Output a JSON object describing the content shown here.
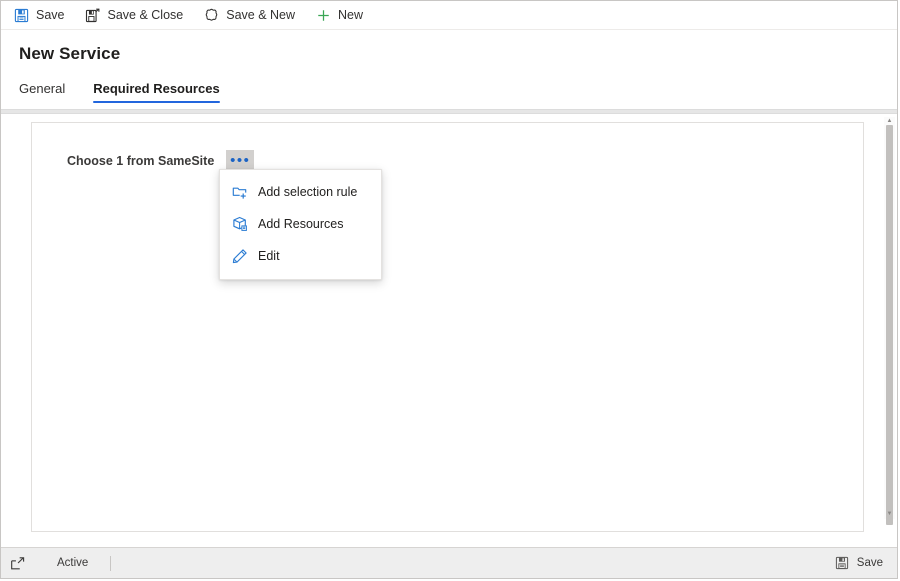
{
  "toolbar": {
    "buttons": [
      {
        "label": "Save",
        "icon": "save-floppy-icon"
      },
      {
        "label": "Save & Close",
        "icon": "save-close-icon"
      },
      {
        "label": "Save & New",
        "icon": "save-new-icon"
      },
      {
        "label": "New",
        "icon": "plus-icon"
      }
    ]
  },
  "header": {
    "title": "New Service",
    "tabs": [
      {
        "label": "General",
        "active": false
      },
      {
        "label": "Required Resources",
        "active": true
      }
    ]
  },
  "content": {
    "field_label": "Choose 1 from SameSite",
    "ellipsis_label": "•••"
  },
  "context_menu": {
    "items": [
      {
        "label": "Add selection rule",
        "icon": "add-selection-rule-icon"
      },
      {
        "label": "Add Resources",
        "icon": "add-resources-box-icon"
      },
      {
        "label": "Edit",
        "icon": "edit-pencil-icon"
      }
    ]
  },
  "statusbar": {
    "popout_icon": "popout-expand-icon",
    "status": "Active",
    "save_label": "Save",
    "save_icon": "save-floppy-gray-icon"
  },
  "colors": {
    "accent_blue": "#2266dd",
    "icon_blue": "#2b7cd3",
    "plus_green": "#3aa655",
    "toolbar_text": "#323130",
    "statusbar_bg": "#eeeeee"
  }
}
